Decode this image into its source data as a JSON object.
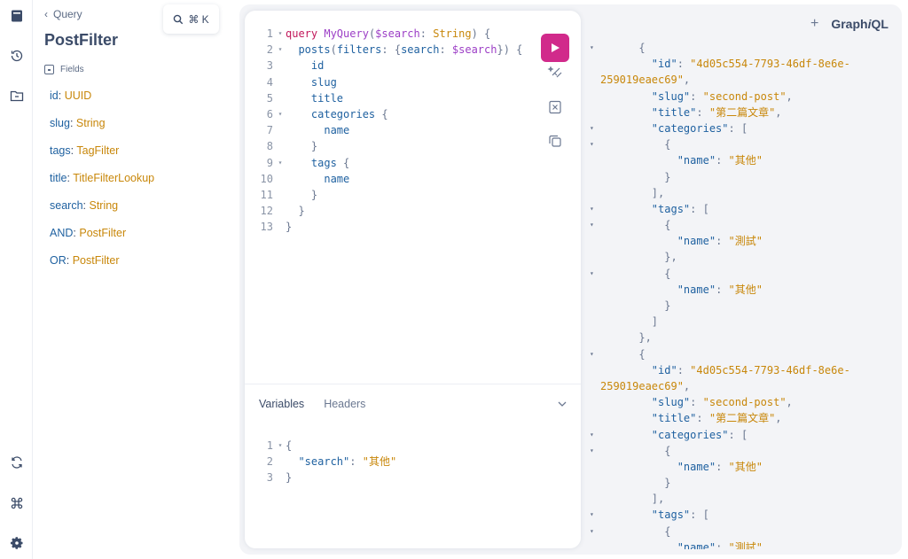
{
  "docs": {
    "back_label": "Query",
    "title": "PostFilter",
    "fields_heading": "Fields",
    "fields": [
      {
        "name": "id",
        "type": "UUID"
      },
      {
        "name": "slug",
        "type": "String"
      },
      {
        "name": "tags",
        "type": "TagFilter"
      },
      {
        "name": "title",
        "type": "TitleFilterLookup"
      },
      {
        "name": "search",
        "type": "String"
      },
      {
        "name": "AND",
        "type": "PostFilter"
      },
      {
        "name": "OR",
        "type": "PostFilter"
      }
    ]
  },
  "search_chip": {
    "shortcut": "⌘ K"
  },
  "editor": {
    "lines": [
      {
        "n": "1",
        "fold": "▾",
        "html": "<span class='kw'>query</span> <span class='def'>MyQuery</span><span class='punc'>(</span><span class='var'>$search</span><span class='punc'>:</span> <span class='typ'>String</span><span class='punc'>) {</span>"
      },
      {
        "n": "2",
        "fold": "▾",
        "html": "  <span class='prop'>posts</span><span class='punc'>(</span><span class='prop'>filters</span><span class='punc'>: {</span><span class='prop'>search</span><span class='punc'>:</span> <span class='var'>$search</span><span class='punc'>}) {</span>"
      },
      {
        "n": "3",
        "fold": "",
        "html": "    <span class='prop'>id</span>"
      },
      {
        "n": "4",
        "fold": "",
        "html": "    <span class='prop'>slug</span>"
      },
      {
        "n": "5",
        "fold": "",
        "html": "    <span class='prop'>title</span>"
      },
      {
        "n": "6",
        "fold": "▾",
        "html": "    <span class='prop'>categories</span> <span class='punc'>{</span>"
      },
      {
        "n": "7",
        "fold": "",
        "html": "      <span class='prop'>name</span>"
      },
      {
        "n": "8",
        "fold": "",
        "html": "    <span class='punc'>}</span>"
      },
      {
        "n": "9",
        "fold": "▾",
        "html": "    <span class='prop'>tags</span> <span class='punc'>{</span>"
      },
      {
        "n": "10",
        "fold": "",
        "html": "      <span class='prop'>name</span>"
      },
      {
        "n": "11",
        "fold": "",
        "html": "    <span class='punc'>}</span>"
      },
      {
        "n": "12",
        "fold": "",
        "html": "  <span class='punc'>}</span>"
      },
      {
        "n": "13",
        "fold": "",
        "html": "<span class='punc'>}</span>"
      }
    ]
  },
  "variables": {
    "tabs": [
      "Variables",
      "Headers"
    ],
    "lines": [
      {
        "n": "1",
        "fold": "▾",
        "html": "<span class='punc'>{</span>"
      },
      {
        "n": "2",
        "fold": "",
        "html": "  <span class='jkey'>\"search\"</span><span class='punc'>:</span> <span class='str'>\"其他\"</span>"
      },
      {
        "n": "3",
        "fold": "",
        "html": "<span class='punc'>}</span>"
      }
    ]
  },
  "result": {
    "lines": [
      {
        "fold": "▾",
        "html": "      <span class='punc'>{</span>"
      },
      {
        "fold": "",
        "html": "        <span class='jkey'>\"id\"</span><span class='punc'>:</span> <span class='str'>\"4d05c554-7793-46df-8e6e-</span>"
      },
      {
        "fold": "",
        "html": "<span class='str'>259019eaec69\"</span><span class='punc'>,</span>"
      },
      {
        "fold": "",
        "html": "        <span class='jkey'>\"slug\"</span><span class='punc'>:</span> <span class='str'>\"second-post\"</span><span class='punc'>,</span>"
      },
      {
        "fold": "",
        "html": "        <span class='jkey'>\"title\"</span><span class='punc'>:</span> <span class='str'>\"第二篇文章\"</span><span class='punc'>,</span>"
      },
      {
        "fold": "▾",
        "html": "        <span class='jkey'>\"categories\"</span><span class='punc'>: [</span>"
      },
      {
        "fold": "▾",
        "html": "          <span class='punc'>{</span>"
      },
      {
        "fold": "",
        "html": "            <span class='jkey'>\"name\"</span><span class='punc'>:</span> <span class='str'>\"其他\"</span>"
      },
      {
        "fold": "",
        "html": "          <span class='punc'>}</span>"
      },
      {
        "fold": "",
        "html": "        <span class='punc'>],</span>"
      },
      {
        "fold": "▾",
        "html": "        <span class='jkey'>\"tags\"</span><span class='punc'>: [</span>"
      },
      {
        "fold": "▾",
        "html": "          <span class='punc'>{</span>"
      },
      {
        "fold": "",
        "html": "            <span class='jkey'>\"name\"</span><span class='punc'>:</span> <span class='str'>\"測試\"</span>"
      },
      {
        "fold": "",
        "html": "          <span class='punc'>},</span>"
      },
      {
        "fold": "▾",
        "html": "          <span class='punc'>{</span>"
      },
      {
        "fold": "",
        "html": "            <span class='jkey'>\"name\"</span><span class='punc'>:</span> <span class='str'>\"其他\"</span>"
      },
      {
        "fold": "",
        "html": "          <span class='punc'>}</span>"
      },
      {
        "fold": "",
        "html": "        <span class='punc'>]</span>"
      },
      {
        "fold": "",
        "html": "      <span class='punc'>},</span>"
      },
      {
        "fold": "▾",
        "html": "      <span class='punc'>{</span>"
      },
      {
        "fold": "",
        "html": "        <span class='jkey'>\"id\"</span><span class='punc'>:</span> <span class='str'>\"4d05c554-7793-46df-8e6e-</span>"
      },
      {
        "fold": "",
        "html": "<span class='str'>259019eaec69\"</span><span class='punc'>,</span>"
      },
      {
        "fold": "",
        "html": "        <span class='jkey'>\"slug\"</span><span class='punc'>:</span> <span class='str'>\"second-post\"</span><span class='punc'>,</span>"
      },
      {
        "fold": "",
        "html": "        <span class='jkey'>\"title\"</span><span class='punc'>:</span> <span class='str'>\"第二篇文章\"</span><span class='punc'>,</span>"
      },
      {
        "fold": "▾",
        "html": "        <span class='jkey'>\"categories\"</span><span class='punc'>: [</span>"
      },
      {
        "fold": "▾",
        "html": "          <span class='punc'>{</span>"
      },
      {
        "fold": "",
        "html": "            <span class='jkey'>\"name\"</span><span class='punc'>:</span> <span class='str'>\"其他\"</span>"
      },
      {
        "fold": "",
        "html": "          <span class='punc'>}</span>"
      },
      {
        "fold": "",
        "html": "        <span class='punc'>],</span>"
      },
      {
        "fold": "▾",
        "html": "        <span class='jkey'>\"tags\"</span><span class='punc'>: [</span>"
      },
      {
        "fold": "▾",
        "html": "          <span class='punc'>{</span>"
      },
      {
        "fold": "",
        "html": "            <span class='jkey'>\"name\"</span><span class='punc'>:</span> <span class='str'>\"測試\"</span>"
      }
    ]
  },
  "brand": {
    "prefix": "Graph",
    "italic": "i",
    "suffix": "QL",
    "add_tab": "+"
  }
}
